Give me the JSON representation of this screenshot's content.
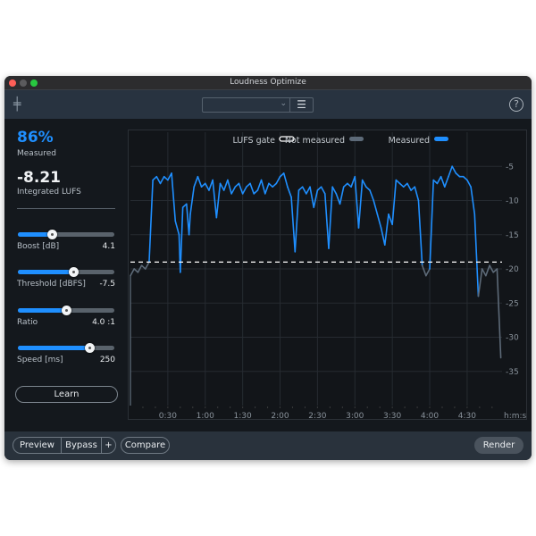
{
  "window": {
    "title": "Loudness Optimize",
    "traffic_colors": [
      "#ff5f57",
      "#5b5b5d",
      "#28c840"
    ]
  },
  "toolbar": {
    "preset_value": "",
    "menu_icon": "hamburger-icon",
    "help_label": "?"
  },
  "stats": {
    "measured_percent": "86%",
    "measured_label": "Measured",
    "integrated_value": "-8.21",
    "integrated_label": "Integrated LUFS"
  },
  "sliders": [
    {
      "name": "Boost [dB]",
      "value": "4.1",
      "level": 0.35
    },
    {
      "name": "Threshold [dBFS]",
      "value": "-7.5",
      "level": 0.57
    },
    {
      "name": "Ratio",
      "value": "4.0 :1",
      "level": 0.5
    },
    {
      "name": "Speed [ms]",
      "value": "250",
      "level": 0.74
    }
  ],
  "learn_label": "Learn",
  "bottom": {
    "preview": "Preview",
    "bypass": "Bypass",
    "plus": "+",
    "compare": "Compare",
    "render": "Render"
  },
  "colors": {
    "accent": "#1f8fff",
    "not_measured": "#5d6a78",
    "gate": "#ffffff"
  },
  "chart_data": {
    "type": "line",
    "legend": [
      {
        "name": "LUFS gate"
      },
      {
        "name": "Not measured"
      },
      {
        "name": "Measured"
      }
    ],
    "legend_position": "top-right",
    "xlabel": "h:m:s",
    "xticks": [
      "0:30",
      "1:00",
      "1:30",
      "2:00",
      "2:30",
      "3:00",
      "3:30",
      "4:00",
      "4:30"
    ],
    "xtick_seconds": [
      30,
      60,
      90,
      120,
      150,
      180,
      210,
      240,
      270
    ],
    "yticks": [
      -5,
      -10,
      -15,
      -20,
      -25,
      -30,
      -35
    ],
    "xlim": [
      0,
      298
    ],
    "ylim": [
      -40,
      0
    ],
    "grid": true,
    "gate": -19,
    "points": [
      [
        0,
        -21
      ],
      [
        3,
        -20
      ],
      [
        6,
        -20.5
      ],
      [
        9,
        -19.5
      ],
      [
        12,
        -20
      ],
      [
        15,
        -19
      ],
      [
        18,
        -7
      ],
      [
        21,
        -6.5
      ],
      [
        24,
        -7.5
      ],
      [
        27,
        -6.5
      ],
      [
        30,
        -7
      ],
      [
        33,
        -6
      ],
      [
        36,
        -13
      ],
      [
        39,
        -15
      ],
      [
        40,
        -20.5
      ],
      [
        42,
        -11
      ],
      [
        45,
        -10.5
      ],
      [
        47,
        -15
      ],
      [
        48,
        -12
      ],
      [
        51,
        -8
      ],
      [
        54,
        -6.5
      ],
      [
        57,
        -8
      ],
      [
        60,
        -7.5
      ],
      [
        63,
        -8.5
      ],
      [
        66,
        -7
      ],
      [
        69,
        -12.5
      ],
      [
        72,
        -7.5
      ],
      [
        75,
        -8.5
      ],
      [
        78,
        -7
      ],
      [
        81,
        -9
      ],
      [
        84,
        -8
      ],
      [
        87,
        -7.5
      ],
      [
        90,
        -9
      ],
      [
        93,
        -8
      ],
      [
        96,
        -7.5
      ],
      [
        99,
        -9
      ],
      [
        102,
        -8.5
      ],
      [
        105,
        -7
      ],
      [
        108,
        -9
      ],
      [
        111,
        -7.5
      ],
      [
        114,
        -8
      ],
      [
        117,
        -7.5
      ],
      [
        120,
        -6.5
      ],
      [
        123,
        -6
      ],
      [
        126,
        -8
      ],
      [
        129,
        -9.5
      ],
      [
        132,
        -17.5
      ],
      [
        135,
        -8.5
      ],
      [
        138,
        -8
      ],
      [
        141,
        -9
      ],
      [
        144,
        -8
      ],
      [
        147,
        -11
      ],
      [
        150,
        -8.5
      ],
      [
        153,
        -8
      ],
      [
        156,
        -9
      ],
      [
        159,
        -17
      ],
      [
        162,
        -8
      ],
      [
        165,
        -9
      ],
      [
        168,
        -10.5
      ],
      [
        171,
        -8
      ],
      [
        174,
        -7.5
      ],
      [
        177,
        -8
      ],
      [
        180,
        -6.5
      ],
      [
        183,
        -14
      ],
      [
        186,
        -7
      ],
      [
        189,
        -8
      ],
      [
        192,
        -8.5
      ],
      [
        195,
        -10
      ],
      [
        198,
        -12
      ],
      [
        201,
        -14
      ],
      [
        204,
        -16.5
      ],
      [
        207,
        -12
      ],
      [
        210,
        -13.5
      ],
      [
        213,
        -7
      ],
      [
        216,
        -7.5
      ],
      [
        219,
        -8
      ],
      [
        222,
        -7.5
      ],
      [
        225,
        -8.5
      ],
      [
        228,
        -8
      ],
      [
        231,
        -10
      ],
      [
        234,
        -19.5
      ],
      [
        237,
        -21
      ],
      [
        240,
        -20
      ],
      [
        243,
        -7
      ],
      [
        246,
        -7.5
      ],
      [
        249,
        -6.5
      ],
      [
        252,
        -8
      ],
      [
        255,
        -6.5
      ],
      [
        258,
        -5
      ],
      [
        261,
        -6
      ],
      [
        264,
        -6.5
      ],
      [
        267,
        -6.5
      ],
      [
        270,
        -7
      ],
      [
        273,
        -8
      ],
      [
        276,
        -12
      ],
      [
        279,
        -24
      ],
      [
        282,
        -20
      ],
      [
        285,
        -21
      ],
      [
        288,
        -19.5
      ],
      [
        291,
        -20.5
      ],
      [
        294,
        -20
      ],
      [
        297,
        -33
      ]
    ]
  }
}
